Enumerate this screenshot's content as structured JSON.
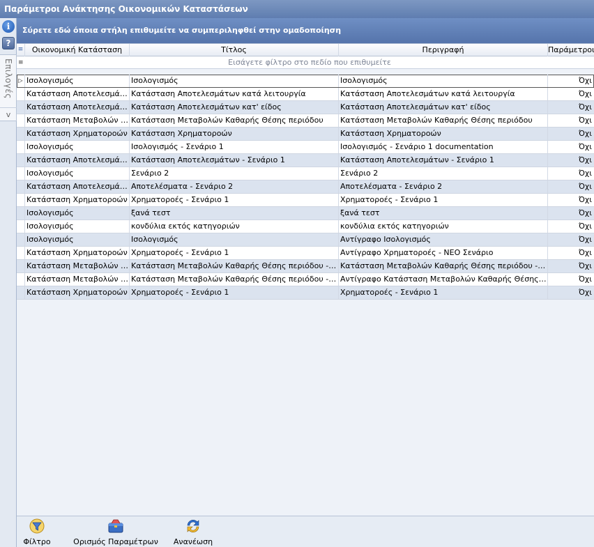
{
  "window": {
    "title": "Παράμετροι Ανάκτησης Οικονομικών Καταστάσεων"
  },
  "sidebar": {
    "info_glyph": "i",
    "help_glyph": "?",
    "tab_label": "Επιλογές",
    "chevron": "v"
  },
  "group_bar": {
    "text": "Σύρετε εδώ όποια στήλη επιθυμείτε να συμπεριληφθεί στην ομαδοποίηση"
  },
  "grid": {
    "columns": [
      "Οικονομική Κατάσταση",
      "Τίτλος",
      "Περιγραφή",
      "Παράμετροι"
    ],
    "filter_placeholder": "Εισάγετε φίλτρο στο πεδίο που επιθυμείτε",
    "rows": [
      [
        "Ισολογισμός",
        "Ισολογισμός",
        "Ισολογισμός",
        "Όχι"
      ],
      [
        "Κατάσταση Αποτελεσμάτων",
        "Κατάσταση Αποτελεσμάτων κατά λειτουργία",
        "Κατάσταση Αποτελεσμάτων κατά λειτουργία",
        "Όχι"
      ],
      [
        "Κατάσταση Αποτελεσμάτων",
        "Κατάσταση Αποτελεσμάτων κατ' είδος",
        "Κατάσταση Αποτελεσμάτων κατ' είδος",
        "Όχι"
      ],
      [
        "Κατάσταση Μεταβολών Καθαρής Θέσης",
        "Κατάσταση Μεταβολών Καθαρής Θέσης περιόδου",
        "Κατάσταση Μεταβολών Καθαρής Θέσης περιόδου",
        "Όχι"
      ],
      [
        "Κατάσταση Χρηματοροών",
        "Κατάσταση Χρηματοροών",
        "Κατάσταση Χρηματοροών",
        "Όχι"
      ],
      [
        "Ισολογισμός",
        "Ισολογισμός - Σενάριο 1",
        "Ισολογισμός - Σενάριο 1 documentation",
        "Όχι"
      ],
      [
        "Κατάσταση Αποτελεσμάτων",
        "Κατάσταση Αποτελεσμάτων - Σενάριο 1",
        "Κατάσταση Αποτελεσμάτων - Σενάριο 1",
        "Όχι"
      ],
      [
        "Ισολογισμός",
        "Σενάριο 2",
        "Σενάριο 2",
        "Όχι"
      ],
      [
        "Κατάσταση Αποτελεσμάτων",
        "Αποτελέσματα - Σενάριο 2",
        "Αποτελέσματα - Σενάριο 2",
        "Όχι"
      ],
      [
        "Κατάσταση Χρηματοροών",
        "Χρηματοροές - Σενάριο 1",
        "Χρηματοροές - Σενάριο 1",
        "Όχι"
      ],
      [
        "Ισολογισμός",
        "ξανά τεστ",
        "ξανά τεστ",
        "Όχι"
      ],
      [
        "Ισολογισμός",
        "κονδύλια εκτός κατηγοριών",
        "κονδύλια εκτός κατηγοριών",
        "Όχι"
      ],
      [
        "Ισολογισμός",
        "Ισολογισμός",
        "Αντίγραφο Ισολογισμός",
        "Όχι"
      ],
      [
        "Κατάσταση Χρηματοροών",
        "Χρηματοροές - Σενάριο 1",
        "Αντίγραφο Χρηματοροές - ΝΕΟ  Σενάριο",
        "Όχι"
      ],
      [
        "Κατάσταση Μεταβολών Καθαρής Θέσης",
        "Κατάσταση Μεταβολών Καθαρής Θέσης περιόδου - Αντίγραφο",
        "Κατάσταση Μεταβολών Καθαρής Θέσης περιόδου - Αντίγραφο",
        "Όχι"
      ],
      [
        "Κατάσταση Μεταβολών Καθαρής Θέσης",
        "Κατάσταση Μεταβολών Καθαρής Θέσης περιόδου - Αντίγραφο",
        "Αντίγραφο Κατάσταση Μεταβολών Καθαρής Θέσης περιόδου",
        "Όχι"
      ],
      [
        "Κατάσταση Χρηματοροών",
        "Χρηματοροές - Σενάριο 1",
        "Χρηματοροές - Σενάριο 1",
        "Όχι"
      ]
    ],
    "row_styles": [
      "sel",
      "plain",
      "alt",
      "plain",
      "alt",
      "plain",
      "alt",
      "plain",
      "alt",
      "plain",
      "alt",
      "plain",
      "alt",
      "plain",
      "alt",
      "plain",
      "alt"
    ]
  },
  "toolbar": {
    "filter_label": "Φίλτρο",
    "params_label": "Ορισμός Παραμέτρων",
    "refresh_label": "Ανανέωση",
    "filter_icon": "filter-funnel-icon",
    "params_icon": "toolbox-icon",
    "refresh_icon": "refresh-arrows-icon"
  }
}
